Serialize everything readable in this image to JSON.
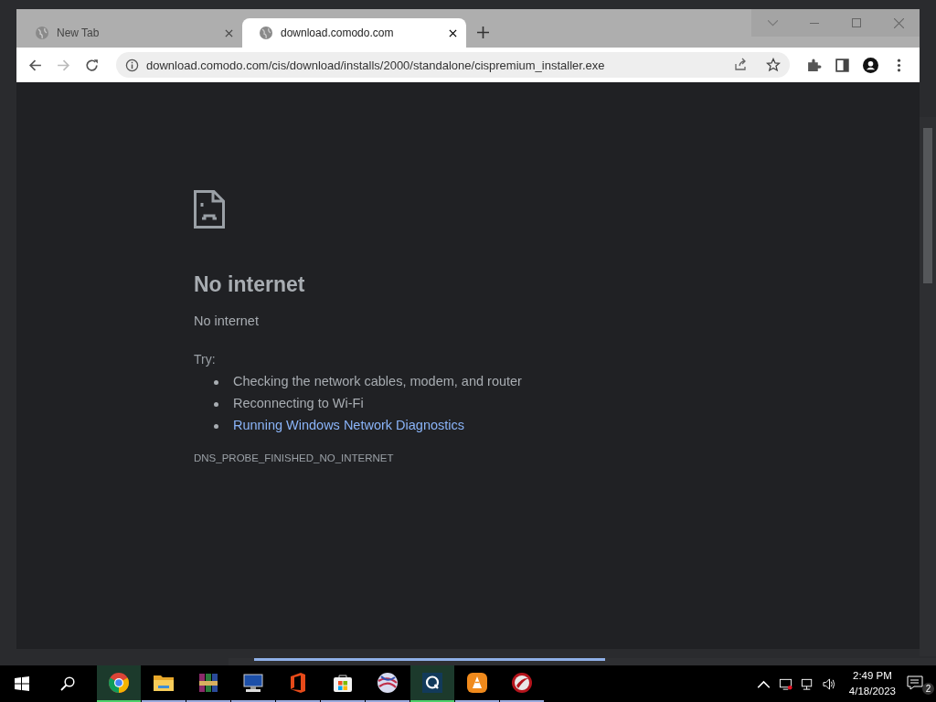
{
  "browser": {
    "tabs": [
      {
        "title": "New Tab",
        "selected": false
      },
      {
        "title": "download.comodo.com",
        "selected": true
      }
    ],
    "address": "download.comodo.com/cis/download/installs/2000/standalone/cispremium_installer.exe"
  },
  "error_page": {
    "heading": "No internet",
    "message": "No internet",
    "try_label": "Try:",
    "suggestions": [
      {
        "text": "Checking the network cables, modem, and router",
        "kind": "text"
      },
      {
        "text": "Reconnecting to Wi-Fi",
        "kind": "text"
      },
      {
        "text": "Running Windows Network Diagnostics",
        "kind": "link"
      }
    ],
    "error_code": "DNS_PROBE_FINISHED_NO_INTERNET"
  },
  "taskbar": {
    "apps": [
      {
        "kind": "chrome",
        "selected": true,
        "running": true
      },
      {
        "kind": "folder",
        "selected": false,
        "running": true
      },
      {
        "kind": "archive",
        "selected": false,
        "running": true
      },
      {
        "kind": "computer",
        "selected": false,
        "running": true
      },
      {
        "kind": "office",
        "selected": false,
        "running": true
      },
      {
        "kind": "store",
        "selected": false,
        "running": true
      },
      {
        "kind": "globe",
        "selected": false,
        "running": true
      },
      {
        "kind": "q",
        "selected": true,
        "running": true
      },
      {
        "kind": "cone",
        "selected": false,
        "running": true
      },
      {
        "kind": "disc",
        "selected": false,
        "running": true
      }
    ],
    "time": "2:49 PM",
    "date": "4/18/2023",
    "notifications": "2"
  }
}
